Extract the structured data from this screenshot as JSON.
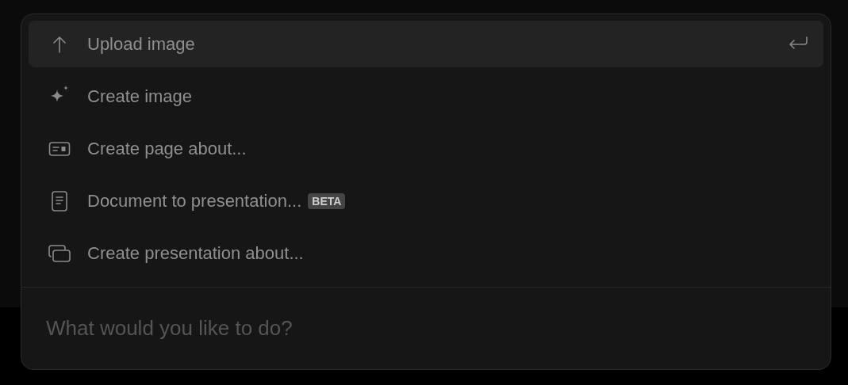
{
  "menu": {
    "items": [
      {
        "label": "Upload image",
        "selected": true
      },
      {
        "label": "Create image",
        "selected": false
      },
      {
        "label": "Create page about...",
        "selected": false
      },
      {
        "label": "Document to presentation...",
        "badge": "BETA",
        "selected": false
      },
      {
        "label": "Create presentation about...",
        "selected": false
      }
    ]
  },
  "prompt": {
    "placeholder": "What would you like to do?"
  }
}
